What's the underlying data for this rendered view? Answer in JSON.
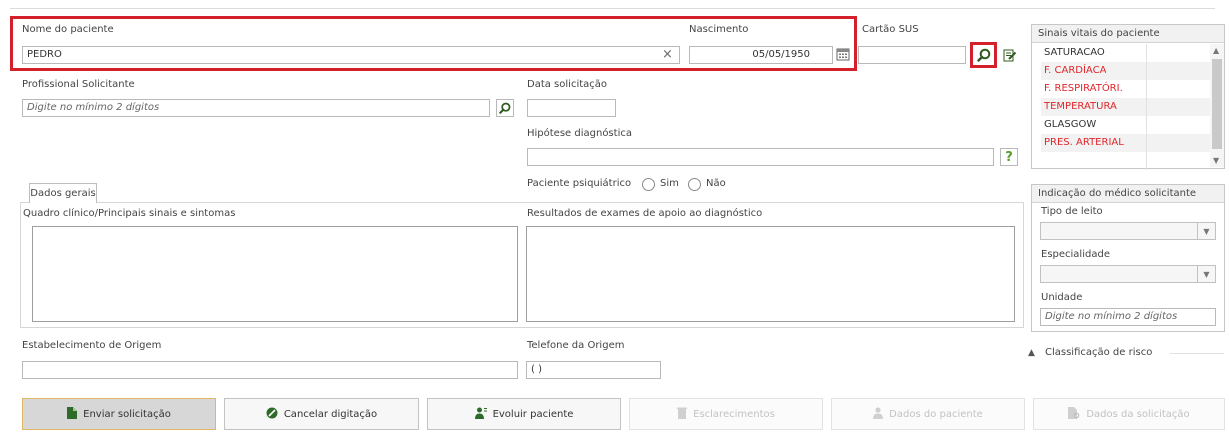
{
  "patient": {
    "name_label": "Nome do paciente",
    "name_value": "PEDRO",
    "clear_icon": "×",
    "birth_label": "Nascimento",
    "birth_value": "05/05/1950",
    "sus_label": "Cartão SUS",
    "sus_value": ""
  },
  "requester": {
    "label": "Profissional Solicitante",
    "placeholder": "Digite no mínimo 2 dígitos",
    "date_label": "Data solicitação",
    "date_value": "",
    "hypothesis_label": "Hipótese diagnóstica",
    "hypothesis_value": "",
    "help_icon": "?"
  },
  "psychiatric": {
    "label": "Paciente psiquiátrico",
    "yes": "Sim",
    "no": "Não"
  },
  "tabs": {
    "general": "Dados gerais"
  },
  "clinical": {
    "symptoms_label": "Quadro clínico/Principais sinais e sintomas",
    "exams_label": "Resultados de exames de apoio ao diagnóstico"
  },
  "origin": {
    "establishment_label": "Estabelecimento de Origem",
    "establishment_value": "",
    "phone_label": "Telefone da Origem",
    "phone_value": "( )"
  },
  "vitals": {
    "title": "Sinais vitais do paciente",
    "items": [
      {
        "label": "SATURACAO",
        "color": "#333333"
      },
      {
        "label": "F. CARDÍACA",
        "color": "#e0262b"
      },
      {
        "label": "F. RESPIRATÓRI.",
        "color": "#e0262b"
      },
      {
        "label": "TEMPERATURA",
        "color": "#e0262b"
      },
      {
        "label": "GLASGOW",
        "color": "#333333"
      },
      {
        "label": "PRES. ARTERIAL",
        "color": "#e0262b"
      }
    ]
  },
  "doctor_indication": {
    "title": "Indicação do médico solicitante",
    "bed_type_label": "Tipo de leito",
    "specialty_label": "Especialidade",
    "unit_label": "Unidade",
    "unit_placeholder": "Digite no mínimo 2 dígitos"
  },
  "risk": {
    "label": "Classificação de risco",
    "colors": [
      "#e3191b",
      "#f47f1a",
      "#ffcc11",
      "#2da52a"
    ]
  },
  "buttons": {
    "send": "Enviar solicitação",
    "cancel": "Cancelar digitação",
    "evolve": "Evoluir paciente",
    "clarifications": "Esclarecimentos",
    "patient_data": "Dados do paciente",
    "request_data": "Dados da solicitação"
  },
  "colors": {
    "highlight": "#d4202a",
    "search_icon": "#2e5b1e",
    "help_icon": "#5a9d2a"
  }
}
